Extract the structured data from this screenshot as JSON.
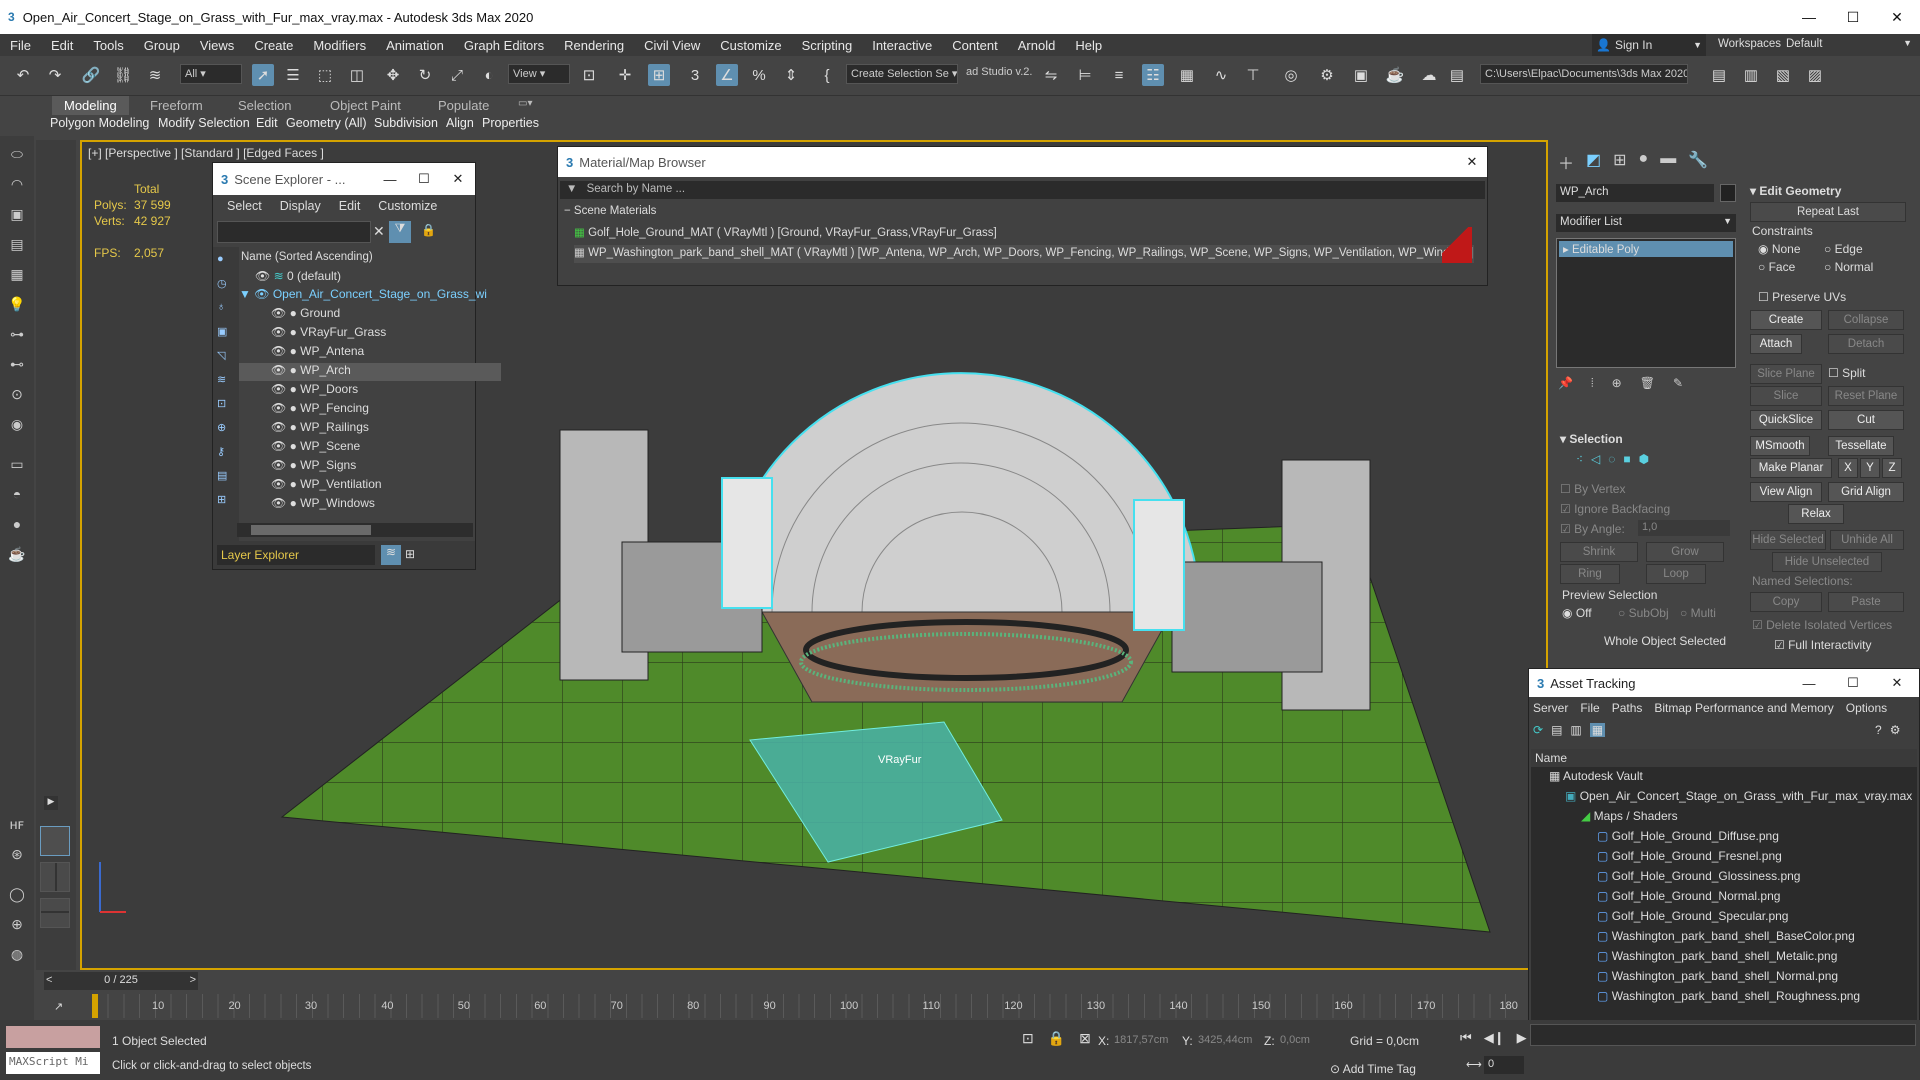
{
  "title_bar": {
    "title": "Open_Air_Concert_Stage_on_Grass_with_Fur_max_vray.max - Autodesk 3ds Max 2020"
  },
  "menu": [
    "File",
    "Edit",
    "Tools",
    "Group",
    "Views",
    "Create",
    "Modifiers",
    "Animation",
    "Graph Editors",
    "Rendering",
    "Civil View",
    "Customize",
    "Scripting",
    "Interactive",
    "Content",
    "Arnold",
    "Help"
  ],
  "account": {
    "sign_in": "Sign In",
    "workspaces_label": "Workspaces:",
    "workspace": "Default"
  },
  "toolbar": {
    "filter": "All",
    "view": "View",
    "named_sel": "Create Selection Se",
    "studio": "ad Studio v.2.",
    "path": "C:\\Users\\Elpac\\Documents\\3ds Max 2020"
  },
  "ribbon": {
    "tabs": [
      "Modeling",
      "Freeform",
      "Selection",
      "Object Paint",
      "Populate"
    ],
    "sub": [
      "Polygon Modeling",
      "Modify Selection",
      "Edit",
      "Geometry (All)",
      "Subdivision",
      "Align",
      "Properties"
    ]
  },
  "viewport": {
    "label": "[+] [Perspective ] [Standard ] [Edged Faces ]",
    "total": "Total",
    "polys_label": "Polys:",
    "polys": "37 599",
    "verts_label": "Verts:",
    "verts": "42 927",
    "fps_label": "FPS:",
    "fps": "2,057",
    "fur_label": "VRayFur"
  },
  "scene_explorer": {
    "title": "Scene Explorer - ...",
    "menu": [
      "Select",
      "Display",
      "Edit",
      "Customize"
    ],
    "header": "Name (Sorted Ascending)",
    "layer_default": "0 (default)",
    "root": "Open_Air_Concert_Stage_on_Grass_wi",
    "items": [
      "Ground",
      "VRayFur_Grass",
      "WP_Antena",
      "WP_Arch",
      "WP_Doors",
      "WP_Fencing",
      "WP_Railings",
      "WP_Scene",
      "WP_Signs",
      "WP_Ventilation",
      "WP_Windows"
    ],
    "footer": "Layer Explorer"
  },
  "material_browser": {
    "title": "Material/Map Browser",
    "search_placeholder": "Search by Name ...",
    "section": "Scene Materials",
    "materials": [
      "Golf_Hole_Ground_MAT ( VRayMtl ) [Ground, VRayFur_Grass,VRayFur_Grass]",
      "WP_Washington_park_band_shell_MAT ( VRayMtl ) [WP_Antena, WP_Arch, WP_Doors, WP_Fencing, WP_Railings, WP_Scene, WP_Signs, WP_Ventilation, WP_Windows]"
    ]
  },
  "command_panel": {
    "object_name": "WP_Arch",
    "modifier_list": "Modifier List",
    "stack_item": "Editable Poly",
    "edit_geometry": "Edit Geometry",
    "repeat_last": "Repeat Last",
    "constraints": "Constraints",
    "c_none": "None",
    "c_edge": "Edge",
    "c_face": "Face",
    "c_normal": "Normal",
    "preserve_uvs": "Preserve UVs",
    "create": "Create",
    "collapse": "Collapse",
    "attach": "Attach",
    "detach": "Detach",
    "slice_plane": "Slice Plane",
    "split": "Split",
    "slice": "Slice",
    "reset_plane": "Reset Plane",
    "quickslice": "QuickSlice",
    "cut": "Cut",
    "msmooth": "MSmooth",
    "tessellate": "Tessellate",
    "make_planar": "Make Planar",
    "x": "X",
    "y": "Y",
    "z": "Z",
    "view_align": "View Align",
    "grid_align": "Grid Align",
    "relax": "Relax",
    "hide_selected": "Hide Selected",
    "unhide_all": "Unhide All",
    "hide_unselected": "Hide Unselected",
    "named_selections": "Named Selections:",
    "copy": "Copy",
    "paste": "Paste",
    "delete_isolated": "Delete Isolated Vertices",
    "full_interactivity": "Full Interactivity",
    "selection": "Selection",
    "by_vertex": "By Vertex",
    "ignore_backfacing": "Ignore Backfacing",
    "by_angle": "By Angle:",
    "angle_val": "1,0",
    "shrink": "Shrink",
    "grow": "Grow",
    "ring": "Ring",
    "loop": "Loop",
    "preview_selection": "Preview Selection",
    "off": "Off",
    "subobj": "SubObj",
    "multi": "Multi",
    "whole_selected": "Whole Object Selected"
  },
  "asset_tracking": {
    "title": "Asset Tracking",
    "menu": [
      "Server",
      "File",
      "Paths",
      "Bitmap Performance and Memory",
      "Options"
    ],
    "col_name": "Name",
    "vault": "Autodesk Vault",
    "file": "Open_Air_Concert_Stage_on_Grass_with_Fur_max_vray.max",
    "maps": "Maps / Shaders",
    "bitmaps": [
      "Golf_Hole_Ground_Diffuse.png",
      "Golf_Hole_Ground_Fresnel.png",
      "Golf_Hole_Ground_Glossiness.png",
      "Golf_Hole_Ground_Normal.png",
      "Golf_Hole_Ground_Specular.png",
      "Washington_park_band_shell_BaseColor.png",
      "Washington_park_band_shell_Metalic.png",
      "Washington_park_band_shell_Normal.png",
      "Washington_park_band_shell_Roughness.png"
    ]
  },
  "timeline": {
    "frame": "0 / 225",
    "ticks": [
      "0",
      "10",
      "20",
      "30",
      "40",
      "50",
      "60",
      "70",
      "80",
      "90",
      "100",
      "110",
      "120",
      "130",
      "140",
      "150",
      "160",
      "170",
      "180"
    ]
  },
  "status": {
    "maxscript": "MAXScript Mi",
    "selected": "1 Object Selected",
    "hint": "Click or click-and-drag to select objects",
    "x_label": "X:",
    "x": "1817,57cm",
    "y_label": "Y:",
    "y": "3425,44cm",
    "z_label": "Z:",
    "z": "0,0cm",
    "grid": "Grid = 0,0cm",
    "add_time_tag": "Add Time Tag",
    "frame_val": "0"
  }
}
